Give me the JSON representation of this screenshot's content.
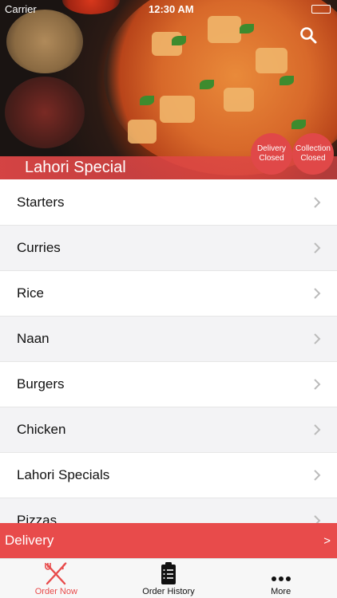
{
  "status_bar": {
    "carrier": "Carrier",
    "time": "12:30 AM"
  },
  "header": {
    "restaurant_name": "Lahori Special",
    "delivery_status": [
      "Delivery",
      "Closed"
    ],
    "collection_status": [
      "Collection",
      "Closed"
    ]
  },
  "menu": {
    "categories": [
      "Starters",
      "Curries",
      "Rice",
      "Naan",
      "Burgers",
      "Chicken",
      "Lahori Specials",
      "Pizzas"
    ]
  },
  "order_type": {
    "label": "Delivery",
    "arrow": ">"
  },
  "tabbar": {
    "tabs": [
      {
        "label": "Order Now",
        "icon": "fork-knife-icon",
        "active": true
      },
      {
        "label": "Order History",
        "icon": "clipboard-icon",
        "active": false
      },
      {
        "label": "More",
        "icon": "more-dots-icon",
        "active": false
      }
    ]
  },
  "colors": {
    "accent": "#e84b4b",
    "row_alt": "#f3f3f5"
  }
}
